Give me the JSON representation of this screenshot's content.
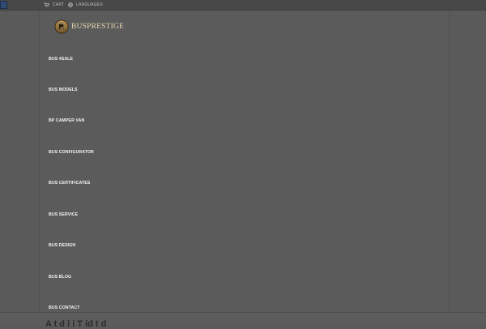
{
  "topbar": {
    "cart_label": "CART",
    "languages_label": "LANGUAGES"
  },
  "logo": {
    "text": "BUSPRESTIGE",
    "brand_color": "#e6d7b1"
  },
  "nav": {
    "items": [
      {
        "label": "BUS 4SALE"
      },
      {
        "label": "BUS MODELS"
      },
      {
        "label": "BP CAMPER VAN"
      },
      {
        "label": "BUS CONFIGURATOR"
      },
      {
        "label": "BUS CERTIFICATES"
      },
      {
        "label": "BUS SERVICE"
      },
      {
        "label": "BUS DESIGN"
      },
      {
        "label": "BUS BLOG"
      },
      {
        "label": "BUS CONTACT"
      }
    ]
  },
  "main": {
    "partial_heading": "A t d i i T id t d"
  }
}
